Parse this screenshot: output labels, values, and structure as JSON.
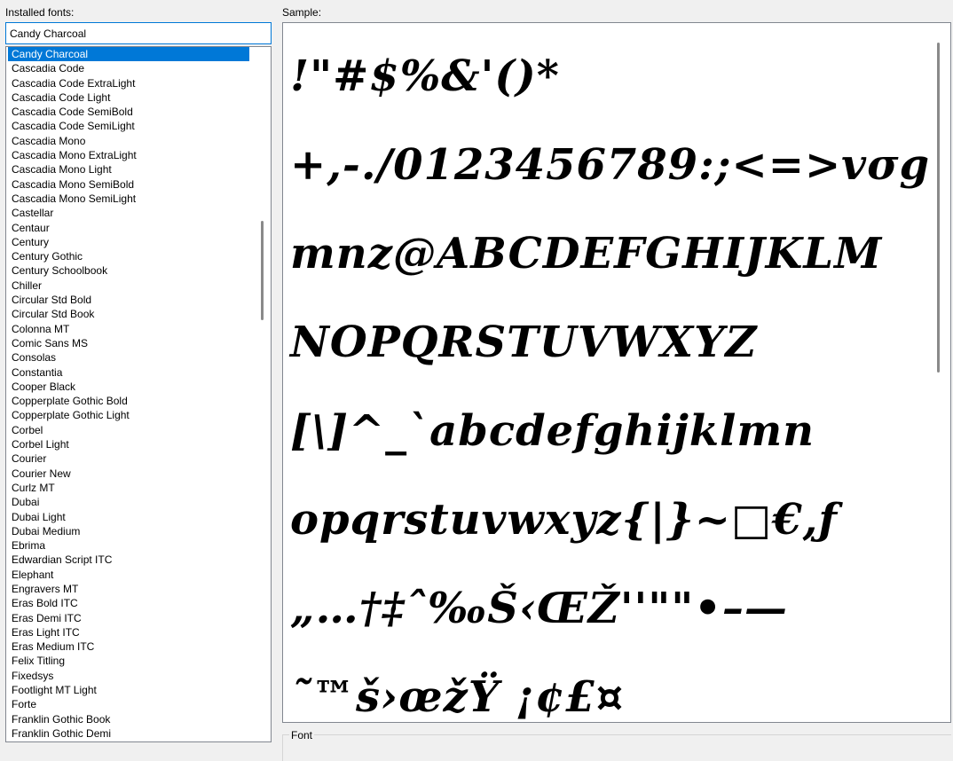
{
  "labels": {
    "installed_fonts": "Installed fonts:",
    "sample": "Sample:",
    "font_group": "Font"
  },
  "font_input": {
    "value": "Candy Charcoal"
  },
  "font_list": {
    "selected": "Candy Charcoal",
    "items": [
      "Candy Charcoal",
      "Cascadia Code",
      "Cascadia Code ExtraLight",
      "Cascadia Code Light",
      "Cascadia Code SemiBold",
      "Cascadia Code SemiLight",
      "Cascadia Mono",
      "Cascadia Mono ExtraLight",
      "Cascadia Mono Light",
      "Cascadia Mono SemiBold",
      "Cascadia Mono SemiLight",
      "Castellar",
      "Centaur",
      "Century",
      "Century Gothic",
      "Century Schoolbook",
      "Chiller",
      "Circular Std Bold",
      "Circular Std Book",
      "Colonna MT",
      "Comic Sans MS",
      "Consolas",
      "Constantia",
      "Cooper Black",
      "Copperplate Gothic Bold",
      "Copperplate Gothic Light",
      "Corbel",
      "Corbel Light",
      "Courier",
      "Courier New",
      "Curlz MT",
      "Dubai",
      "Dubai Light",
      "Dubai Medium",
      "Ebrima",
      "Edwardian Script ITC",
      "Elephant",
      "Engravers MT",
      "Eras Bold ITC",
      "Eras Demi ITC",
      "Eras Light ITC",
      "Eras Medium ITC",
      "Felix Titling",
      "Fixedsys",
      "Footlight MT Light",
      "Forte",
      "Franklin Gothic Book",
      "Franklin Gothic Demi"
    ]
  },
  "sample": {
    "text": "!\"#$%&'()*\n+,-./0123456789:;<=>vσg\nmnz@ABCDEFGHIJKLM\nNOPQRSTUVWXYZ\n[\\]^_`abcdefghijklmn\nopqrstuvwxyz{|}~□€,ƒ\n„…†‡ˆ‰Š‹ŒŽ''\"\"•–—\n˜™š›œžŸ ¡¢£¤"
  }
}
